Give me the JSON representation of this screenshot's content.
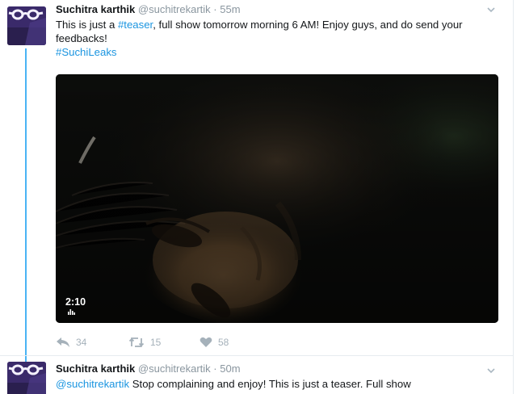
{
  "tweets": [
    {
      "name": "Suchitra karthik",
      "handle": "@suchitrekartik",
      "separator": "·",
      "time": "55m",
      "text_part1": "This is just a ",
      "text_hashtag": "#teaser",
      "text_part2": ", full show tomorrow morning 6 AM! Enjoy guys, and do send your feedbacks!",
      "text_hashtag2": "#SuchiLeaks",
      "video_duration": "2:10",
      "actions": {
        "reply_count": "34",
        "retweet_count": "15",
        "like_count": "58"
      }
    },
    {
      "name": "Suchitra karthik",
      "handle": "@suchitrekartik",
      "separator": "·",
      "time": "50m",
      "mention": "@suchitrekartik",
      "text": " Stop complaining and enjoy! This is just a teaser. Full show"
    }
  ],
  "colors": {
    "link": "#1b95e0",
    "thread_line": "#4ab3f4",
    "muted": "#8a969f",
    "action": "#a5b1ba"
  },
  "icons": {
    "reply": "reply-icon",
    "retweet": "retweet-icon",
    "like": "heart-icon",
    "caret": "chevron-down-icon",
    "audio": "audio-bars-icon"
  }
}
